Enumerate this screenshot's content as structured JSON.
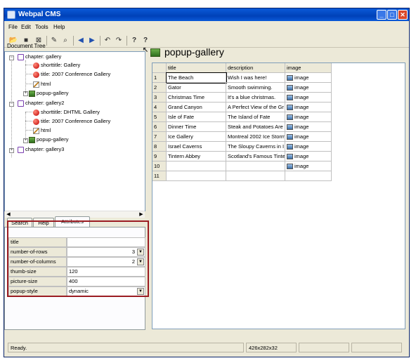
{
  "window": {
    "title": "Webpal CMS"
  },
  "menu": [
    "File",
    "Edit",
    "Tools",
    "Help"
  ],
  "toolbar": {
    "icons": [
      "open-icon",
      "save-icon",
      "close-doc-icon",
      "edit-icon",
      "zoom-icon",
      "back-icon",
      "forward-icon",
      "undo-icon",
      "redo-icon",
      "help-icon",
      "context-help-icon"
    ]
  },
  "left": {
    "tree_label": "Document Tree",
    "tree": [
      {
        "label": "chapter: gallery",
        "icon": "book-icon"
      },
      {
        "label": "shorttitle: Gallery",
        "icon": "bullet-icon"
      },
      {
        "label": "title: 2007 Conference Gallery",
        "icon": "bullet-icon"
      },
      {
        "label": "html",
        "icon": "pen-icon"
      },
      {
        "label": "popup-gallery",
        "icon": "gallery-icon"
      },
      {
        "label": "chapter: gallery2",
        "icon": "book-icon"
      },
      {
        "label": "shorttitle: DHTML Gallery",
        "icon": "bullet-icon"
      },
      {
        "label": "title: 2007 Conference Gallery",
        "icon": "bullet-icon"
      },
      {
        "label": "html",
        "icon": "pen-icon"
      },
      {
        "label": "popup-gallery",
        "icon": "gallery-icon"
      },
      {
        "label": "chapter: gallery3",
        "icon": "book-icon"
      }
    ],
    "tabs": [
      "Search",
      "Help",
      "Attributes"
    ],
    "attributes": [
      {
        "key": "title",
        "value": ""
      },
      {
        "key": "number-of-rows",
        "value": "3"
      },
      {
        "key": "number-of-columns",
        "value": "2"
      },
      {
        "key": "thumb-size",
        "value": "120"
      },
      {
        "key": "picture-size",
        "value": "400"
      },
      {
        "key": "popup-style",
        "value": "dynamic"
      }
    ]
  },
  "right": {
    "heading": "popup-gallery",
    "columns": [
      "title",
      "description",
      "image"
    ],
    "rows": [
      {
        "n": "1",
        "title": "The Beach",
        "description": "Wish I was here!",
        "image": "image"
      },
      {
        "n": "2",
        "title": "Gator",
        "description": "Smooth swimming.",
        "image": "image"
      },
      {
        "n": "3",
        "title": "Christmas Time",
        "description": "It's a blue christmas.",
        "image": "image"
      },
      {
        "n": "4",
        "title": "Grand Canyon",
        "description": "A Perfect View of the Gr",
        "image": "image"
      },
      {
        "n": "5",
        "title": "Isle of Fate",
        "description": "The Island of Fate",
        "image": "image"
      },
      {
        "n": "6",
        "title": "Dinner Time",
        "description": "Steak and Potatoes Are",
        "image": "image"
      },
      {
        "n": "7",
        "title": "Ice Gallery",
        "description": "Montreal 2002 Ice Storm",
        "image": "image"
      },
      {
        "n": "8",
        "title": "Israel Caverns",
        "description": "The Sloupy Caverns in I",
        "image": "image"
      },
      {
        "n": "9",
        "title": "Tintern Abbey",
        "description": "Scotland's Famous Tinte",
        "image": "image"
      },
      {
        "n": "10",
        "title": "",
        "description": "",
        "image": "image"
      },
      {
        "n": "11",
        "title": "",
        "description": "",
        "image": ""
      }
    ]
  },
  "status": {
    "text": "Ready.",
    "size": "426x282x32"
  },
  "colors": {
    "highlight_box": "#9b1c22",
    "arrow": "#9b1c22"
  }
}
